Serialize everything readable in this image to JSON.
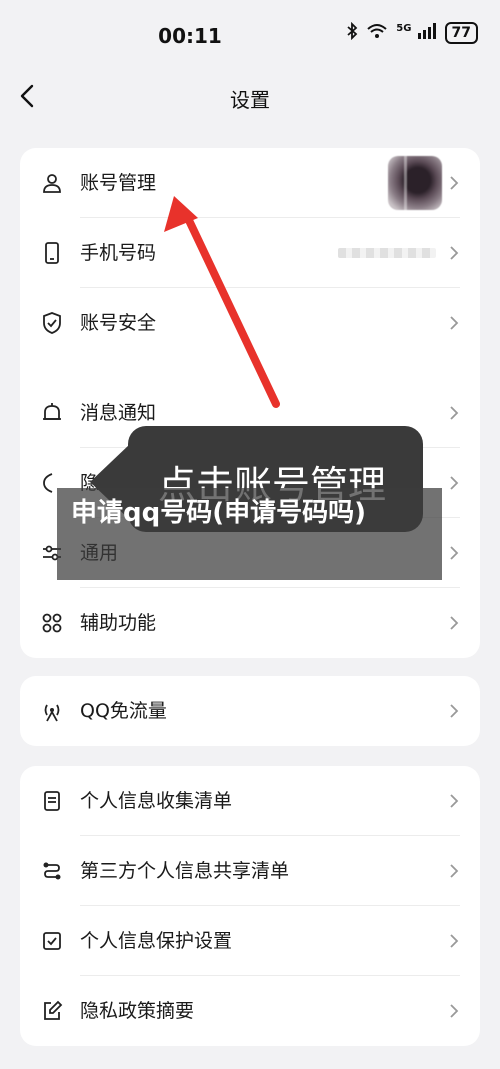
{
  "status_bar": {
    "time": "00:11",
    "network": "5G",
    "battery": "77"
  },
  "nav": {
    "title": "设置"
  },
  "group1": [
    {
      "label": "账号管理",
      "icon": "person-icon"
    },
    {
      "label": "手机号码",
      "icon": "phone-icon"
    },
    {
      "label": "账号安全",
      "icon": "shield-icon"
    },
    {
      "label": "消息通知",
      "icon": "bell-icon"
    },
    {
      "label": "隐私",
      "icon": "privacy-icon"
    },
    {
      "label": "通用",
      "icon": "sliders-icon"
    },
    {
      "label": "辅助功能",
      "icon": "grid-icon"
    }
  ],
  "group2": [
    {
      "label": "QQ免流量",
      "icon": "signal-icon"
    }
  ],
  "group3": [
    {
      "label": "个人信息收集清单",
      "icon": "document-icon"
    },
    {
      "label": "第三方个人信息共享清单",
      "icon": "share-icon"
    },
    {
      "label": "个人信息保护设置",
      "icon": "checkbox-icon"
    },
    {
      "label": "隐私政策摘要",
      "icon": "edit-icon"
    }
  ],
  "tooltip": {
    "text": "点击账号管理"
  },
  "banner": {
    "text": "申请qq号码(申请号码吗)"
  },
  "colors": {
    "arrow": "#e8322b",
    "tooltip_bg": "#3a3a3a"
  }
}
